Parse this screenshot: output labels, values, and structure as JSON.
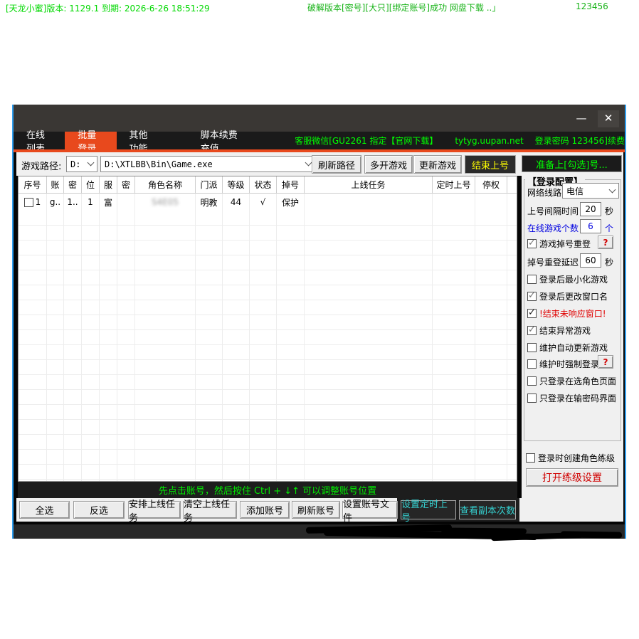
{
  "colors": {
    "accent_red": "#e8491d",
    "notice_green": "#00ff00",
    "status_green": "#00d800",
    "cyan_button_text": "#35d0d0",
    "yellow_button_text": "#ffff00",
    "frame_blue": "#2f9ff0"
  },
  "titlebar": {
    "minimize": "—",
    "close": "✕"
  },
  "tabs": [
    {
      "label": "在线列表",
      "active": false
    },
    {
      "label": "批量登录",
      "active": true
    },
    {
      "label": "其他功能",
      "active": false
    },
    {
      "label": "脚本续费充值",
      "active": false
    }
  ],
  "tab_notices": {
    "support": "客服微信[GU2261 指定【官网下载】",
    "site": "tytyg.uupan.net",
    "password": "登录密码 123456]续费"
  },
  "toolbar": {
    "path_label": "游戏路径:",
    "drive_value": "D:",
    "game_path": "D:\\XTLBB\\Bin\\Game.exe",
    "refresh_path": "刷新路径",
    "multi_open": "多开游戏",
    "update_game": "更新游戏",
    "end_login": "结束上号"
  },
  "banner": "准备上[勾选]号...",
  "table": {
    "headers": [
      "序号",
      "账",
      "密",
      "位",
      "服",
      "密",
      "角色名称",
      "门派",
      "等级",
      "状态",
      "掉号",
      "上线任务",
      "定时上号",
      "停权",
      ""
    ],
    "row": [
      "1",
      "g..",
      "1..",
      "1",
      "富",
      "",
      "S4E05",
      "明教",
      "44",
      "√",
      "保护",
      "",
      "",
      "",
      ""
    ],
    "row_checked": false
  },
  "hint_bar": "先点击账号，然后按住 Ctrl + ↓↑ 可以调整账号位置",
  "bottom_buttons": {
    "select_all": "全选",
    "invert_select": "反选",
    "arrange_task": "安排上线任务",
    "clear_task": "清空上线任务",
    "add_account": "添加账号",
    "refresh_account": "刷新账号",
    "set_account_file": "设置账号文件",
    "set_timed_login": "设置定时上号",
    "view_dungeon_count": "查看副本次数"
  },
  "login_config": {
    "group_title": "【登录配置】",
    "network": {
      "label": "网络线路",
      "value": "电信"
    },
    "interval": {
      "label": "上号间隔时间",
      "value": "20",
      "unit": "秒"
    },
    "online": {
      "label": "在线游戏个数",
      "value": "6",
      "unit": "个"
    },
    "relogin": {
      "label": "游戏掉号重登",
      "checked": true,
      "muted": true,
      "help": "?"
    },
    "delay": {
      "label": "掉号重登延迟",
      "value": "60",
      "unit": "秒"
    },
    "checks": [
      {
        "label": "登录后最小化游戏",
        "checked": false
      },
      {
        "label": "登录后更改窗口名",
        "checked": true,
        "muted": true
      },
      {
        "label": "!结束未响应窗口!",
        "checked": true,
        "red": true
      },
      {
        "label": "结束异常游戏",
        "checked": true,
        "muted": true
      },
      {
        "label": "维护自动更新游戏",
        "checked": false
      },
      {
        "label": "维护时强制登录",
        "checked": false,
        "help": "?"
      },
      {
        "label": "只登录在选角色页面",
        "checked": false
      },
      {
        "label": "只登录在输密码界面",
        "checked": false
      }
    ],
    "create_role": {
      "label": "登录时创建角色练级",
      "checked": false
    },
    "open_training_button": "打开练级设置"
  },
  "status_bar": {
    "left": "[天龙小蜜]版本: 1129.1  到期: 2026-6-26 18:51:29",
    "redacted": "破解版本[密号][大只][绑定账号]成功  网盘下载 ..」",
    "code": "123456"
  }
}
